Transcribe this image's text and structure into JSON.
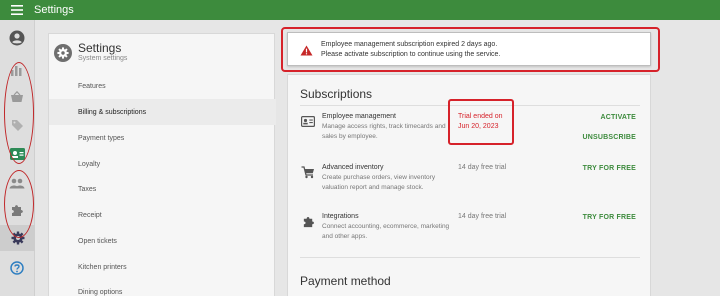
{
  "header": {
    "title": "Settings"
  },
  "settings": {
    "title": "Settings",
    "subtitle": "System settings",
    "nav": [
      {
        "label": "Features"
      },
      {
        "label": "Billing & subscriptions"
      },
      {
        "label": "Payment types"
      },
      {
        "label": "Loyalty"
      },
      {
        "label": "Taxes"
      },
      {
        "label": "Receipt"
      },
      {
        "label": "Open tickets"
      },
      {
        "label": "Kitchen printers"
      },
      {
        "label": "Dining options"
      }
    ]
  },
  "alert": {
    "line1": "Employee management subscription expired 2 days ago.",
    "line2": "Please activate subscription to continue using the service."
  },
  "subscriptions": {
    "title": "Subscriptions",
    "items": [
      {
        "name": "Employee management",
        "description": "Manage access rights, track timecards and sales by employee.",
        "status_line1": "Trial ended on",
        "status_line2": "Jun 20, 2023",
        "actions": [
          "ACTIVATE",
          "UNSUBSCRIBE"
        ],
        "icon": "badge-icon"
      },
      {
        "name": "Advanced inventory",
        "description": "Create purchase orders, view inventory valuation report and manage stock.",
        "status": "14 day free trial",
        "actions": [
          "TRY FOR FREE"
        ],
        "icon": "cart-icon"
      },
      {
        "name": "Integrations",
        "description": "Connect accounting, ecommerce, marketing and other apps.",
        "status": "14 day free trial",
        "actions": [
          "TRY FOR FREE"
        ],
        "icon": "puzzle-icon"
      }
    ]
  },
  "payment": {
    "title": "Payment method"
  },
  "colors": {
    "primary": "#3d8b3d",
    "danger": "#d6222a"
  }
}
